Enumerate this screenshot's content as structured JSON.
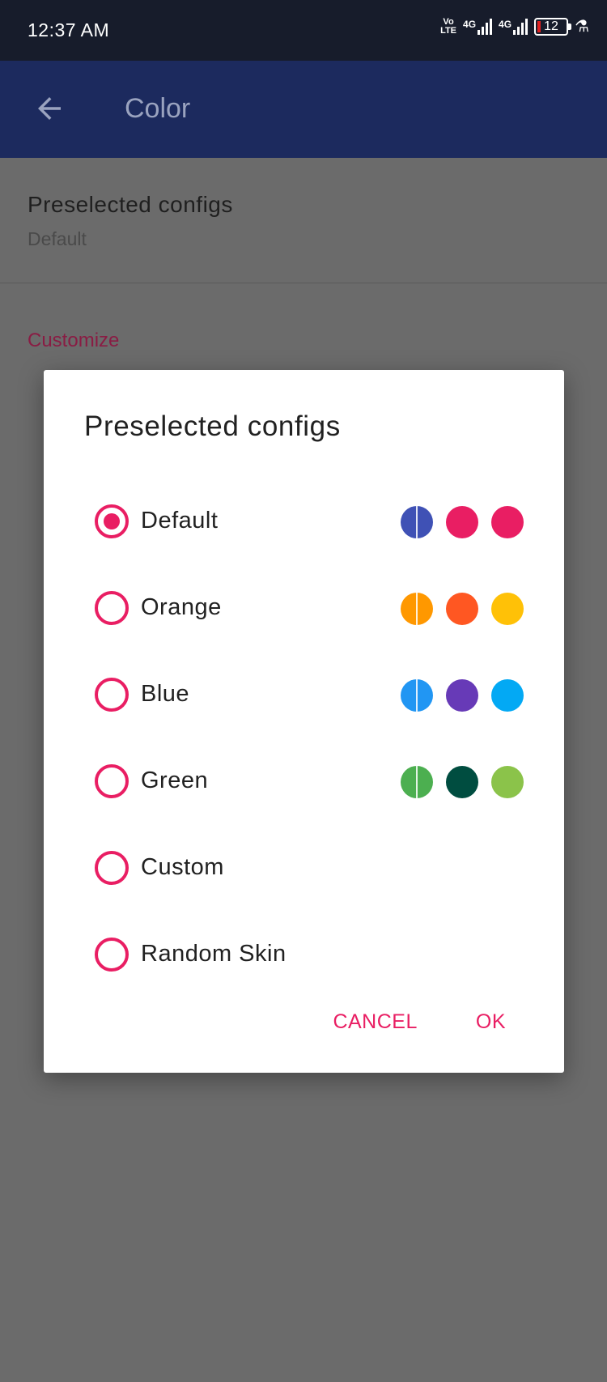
{
  "status_bar": {
    "time": "12:37 AM",
    "volte_top": "Vo",
    "volte_bottom": "LTE",
    "net1": "4G",
    "net2": "4G",
    "battery": "12"
  },
  "toolbar": {
    "title": "Color",
    "back_icon": "arrow-left-icon"
  },
  "background": {
    "pref_title": "Preselected configs",
    "pref_summary": "Default",
    "category": "Customize"
  },
  "dialog": {
    "title": "Preselected configs",
    "options": [
      {
        "label": "Default",
        "checked": true,
        "colors": [
          "#3f51b5",
          "#e91e63",
          "#e91e63"
        ]
      },
      {
        "label": "Orange",
        "checked": false,
        "colors": [
          "#ff9800",
          "#ff5722",
          "#ffc107"
        ]
      },
      {
        "label": "Blue",
        "checked": false,
        "colors": [
          "#2196f3",
          "#673ab7",
          "#03a9f4"
        ]
      },
      {
        "label": "Green",
        "checked": false,
        "colors": [
          "#4caf50",
          "#004d40",
          "#8bc34a"
        ]
      },
      {
        "label": "Custom",
        "checked": false,
        "colors": []
      },
      {
        "label": "Random Skin",
        "checked": false,
        "colors": []
      }
    ],
    "cancel_label": "CANCEL",
    "ok_label": "OK"
  },
  "colors": {
    "accent": "#e91e63",
    "toolbar": "#1c2a5e",
    "scrim": "#6b6b6b"
  }
}
